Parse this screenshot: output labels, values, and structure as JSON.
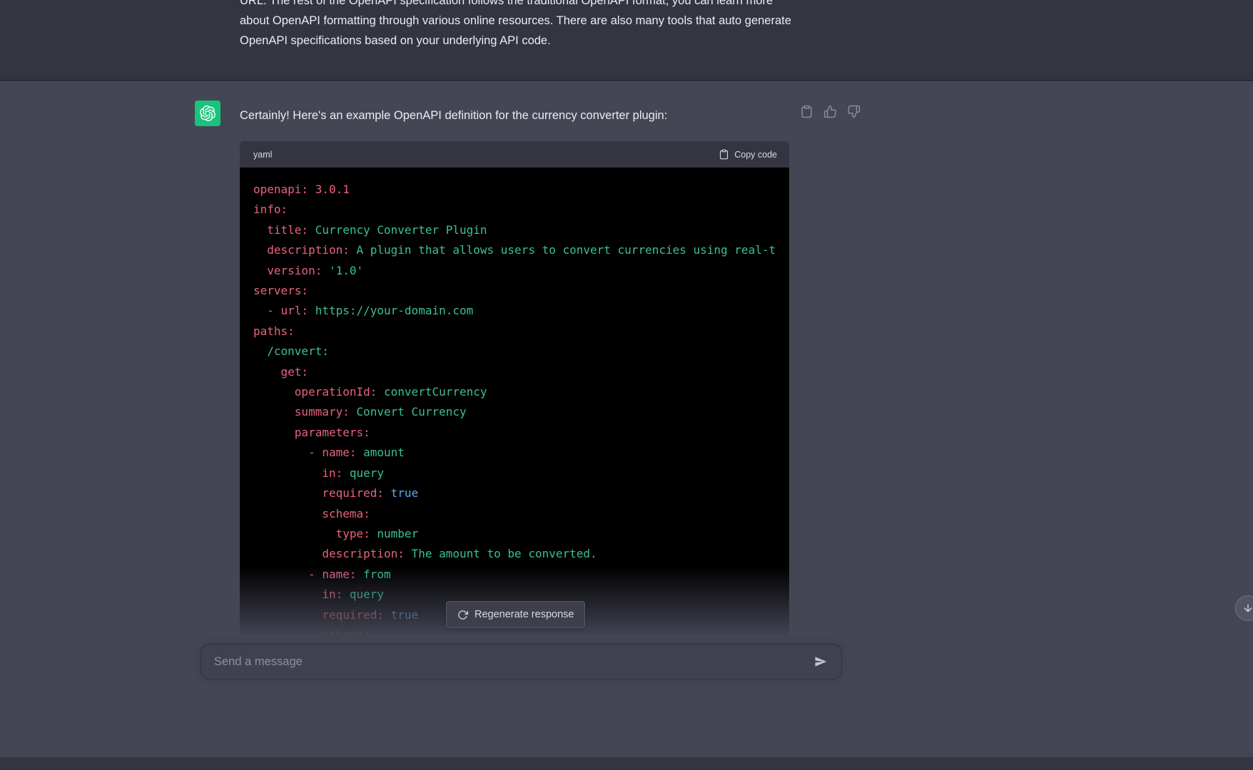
{
  "colors": {
    "bg-main": "#343541",
    "bg-assistant": "#444654",
    "bg-code": "#000000",
    "bg-code-header": "#343541",
    "bg-input": "#40414f",
    "accent-avatar": "#19c37d",
    "text-primary": "#ececf1",
    "text-muted": "#8e8ea0",
    "tok-key": "#e9637d",
    "tok-str": "#3ac28f",
    "tok-bool": "#5ba8f5",
    "tok-num": "#e9637d"
  },
  "user_message": {
    "text": "URL. The rest of the OpenAPI specification follows the traditional OpenAPI format, you can learn more about OpenAPI formatting through various online resources. There are also many tools that auto generate OpenAPI specifications based on your underlying API code."
  },
  "assistant_message": {
    "intro": "Certainly! Here's an example OpenAPI definition for the currency converter plugin:",
    "action_icons": [
      "clipboard-icon",
      "thumbs-up-icon",
      "thumbs-down-icon"
    ]
  },
  "code_block": {
    "language": "yaml",
    "copy_label": "Copy code",
    "copy_icon": "clipboard-icon",
    "lines": [
      [
        {
          "t": "openapi:",
          "c": "key"
        },
        {
          "t": " 3.0.1",
          "c": "num"
        }
      ],
      [
        {
          "t": "info:",
          "c": "key"
        }
      ],
      [
        {
          "t": "  title:",
          "c": "key"
        },
        {
          "t": " Currency Converter Plugin",
          "c": "str"
        }
      ],
      [
        {
          "t": "  description:",
          "c": "key"
        },
        {
          "t": " A plugin that allows users to convert currencies using real-t",
          "c": "str"
        }
      ],
      [
        {
          "t": "  version:",
          "c": "key"
        },
        {
          "t": " '1.0'",
          "c": "str"
        }
      ],
      [
        {
          "t": "servers:",
          "c": "key"
        }
      ],
      [
        {
          "t": "  - url:",
          "c": "key"
        },
        {
          "t": " https://your-domain.com",
          "c": "str"
        }
      ],
      [
        {
          "t": "paths:",
          "c": "key"
        }
      ],
      [
        {
          "t": "  /convert:",
          "c": "str"
        }
      ],
      [
        {
          "t": "    get:",
          "c": "key"
        }
      ],
      [
        {
          "t": "      operationId:",
          "c": "key"
        },
        {
          "t": " convertCurrency",
          "c": "str"
        }
      ],
      [
        {
          "t": "      summary:",
          "c": "key"
        },
        {
          "t": " Convert Currency",
          "c": "str"
        }
      ],
      [
        {
          "t": "      parameters:",
          "c": "key"
        }
      ],
      [
        {
          "t": "        - name:",
          "c": "key"
        },
        {
          "t": " amount",
          "c": "str"
        }
      ],
      [
        {
          "t": "          in:",
          "c": "key"
        },
        {
          "t": " query",
          "c": "str"
        }
      ],
      [
        {
          "t": "          required:",
          "c": "key"
        },
        {
          "t": " true",
          "c": "bool"
        }
      ],
      [
        {
          "t": "          schema:",
          "c": "key"
        }
      ],
      [
        {
          "t": "            type:",
          "c": "key"
        },
        {
          "t": " number",
          "c": "str"
        }
      ],
      [
        {
          "t": "          description:",
          "c": "key"
        },
        {
          "t": " The amount to be converted.",
          "c": "str"
        }
      ],
      [
        {
          "t": "        - name:",
          "c": "key"
        },
        {
          "t": " from",
          "c": "str"
        }
      ],
      [
        {
          "t": "          in:",
          "c": "key"
        },
        {
          "t": " query",
          "c": "str"
        }
      ],
      [
        {
          "t": "          required:",
          "c": "key"
        },
        {
          "t": " true",
          "c": "bool"
        }
      ],
      [
        {
          "t": "          schema:",
          "c": "key"
        }
      ]
    ]
  },
  "regenerate": {
    "label": "Regenerate response",
    "icon": "refresh-icon"
  },
  "composer": {
    "placeholder": "Send a message",
    "value": "",
    "send_icon": "send-icon"
  },
  "scroll_button": {
    "icon": "arrow-down-icon"
  },
  "avatar": {
    "icon": "openai-logo-icon"
  }
}
